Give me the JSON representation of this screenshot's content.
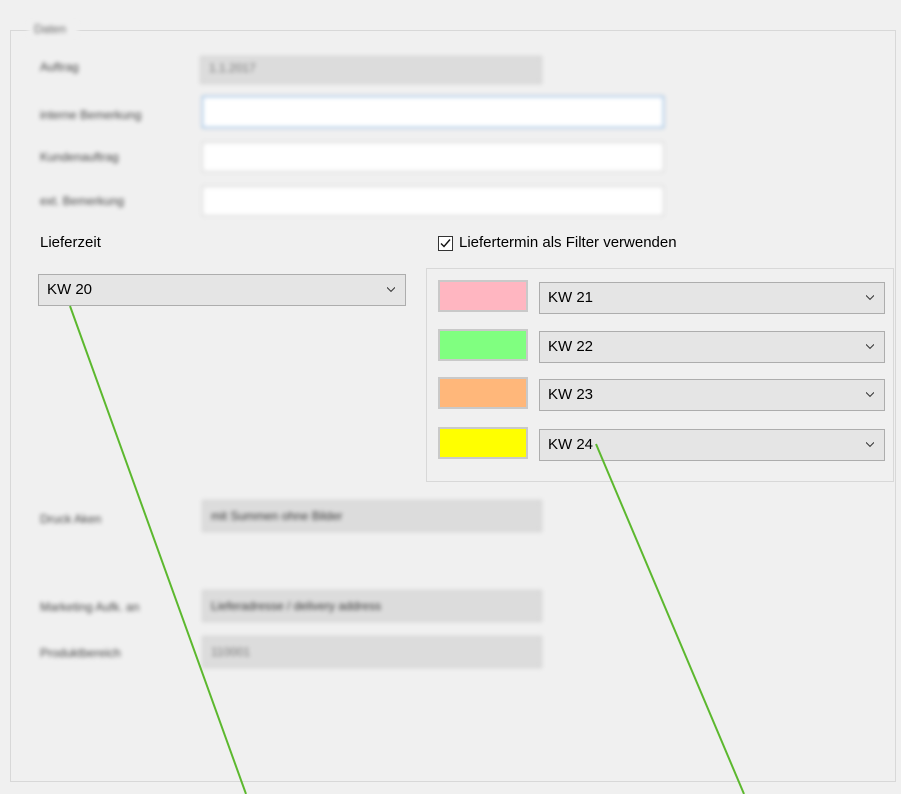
{
  "group": {
    "legend": "Daten"
  },
  "form_rows": [
    {
      "label": "Auftrag",
      "value": "1.1.2017"
    },
    {
      "label": "interne Bemerkung",
      "value": ""
    },
    {
      "label": "Kundenauftrag",
      "value": ""
    },
    {
      "label": "ext. Bemerkung",
      "value": ""
    }
  ],
  "lieferzeit": {
    "label": "Lieferzeit",
    "value": "KW 20"
  },
  "filter": {
    "checkbox_label": "Liefertermin als Filter verwenden",
    "checked": true,
    "items": [
      {
        "color": "#ffb6c1",
        "value": "KW 21"
      },
      {
        "color": "#80ff80",
        "value": "KW 22"
      },
      {
        "color": "#ffb77a",
        "value": "KW 23"
      },
      {
        "color": "#ffff00",
        "value": "KW 24"
      }
    ]
  },
  "druck": {
    "label": "Druck Aken",
    "value": "mit Summen ohne Bilder"
  },
  "marketing": {
    "label": "Marketing Aufk. an",
    "value": "Lieferadresse / delivery address"
  },
  "produkt": {
    "label": "Produktbereich",
    "value": "110001"
  },
  "colors": {
    "callout_line": "#5cb82e"
  }
}
